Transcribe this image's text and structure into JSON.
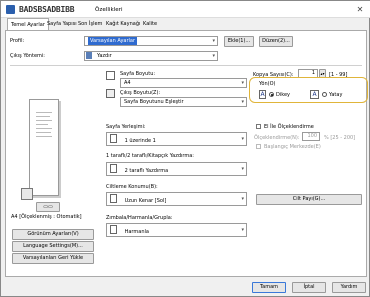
{
  "window": {
    "printer_name": "BADSBSADBIBB",
    "title": "Özellikleri",
    "close_glyph": "✕"
  },
  "tabs": [
    {
      "label": "Temel Ayarlar",
      "active": true
    },
    {
      "label": "Sayfa Yapısı",
      "active": false
    },
    {
      "label": "Son İşlem",
      "active": false
    },
    {
      "label": "Kağıt Kaynağı",
      "active": false
    },
    {
      "label": "Kalite",
      "active": false
    }
  ],
  "profile": {
    "label": "Profil:",
    "value": "Varsayılan Ayarlar",
    "add_button": "Ekle(1)...",
    "edit_button": "Düzen(2)..."
  },
  "output": {
    "label": "Çıkış Yöntemi:",
    "value": "Yazdır"
  },
  "page_size": {
    "label": "Sayfa Boyutu:",
    "value": "A4"
  },
  "output_size": {
    "label": "Çıkış Boyutu(Z):",
    "value": "Sayfa Boyutunu Eşleştir"
  },
  "copies": {
    "label": "Kopya Sayısı(C):",
    "value": "1",
    "range": "[1 - 99]"
  },
  "orientation": {
    "label": "Yön(O)",
    "portrait": "Dikey",
    "landscape": "Yatay",
    "selected": "portrait"
  },
  "layout": {
    "label": "Sayfa Yerleşimi:",
    "value": "1 üzerinde 1"
  },
  "manual_scaling": {
    "label": "El İle Ölçeklendirme",
    "scaling_label": "Ölçeklendirme(N):",
    "scaling_value": "100",
    "scaling_range": "% [25 - 200]",
    "booklet_label": "Başlangıç Merkezde(E)"
  },
  "duplex": {
    "label": "1 taraflı/2 taraflı/Kitapçık Yazdırma:",
    "value": "2 taraflı Yazdırma"
  },
  "binding": {
    "label": "Ciltleme Konumu(B):",
    "value": "Uzun Kenar [Sol]",
    "gutter_button": "Cilt Payı(G)..."
  },
  "finishing": {
    "label": "Zımbala/Harmanla/Grupla:",
    "value": "Harmanla"
  },
  "preview": {
    "caption": "A4 [Ölçeklenmiş : Otomatik]"
  },
  "left_buttons": {
    "view_settings": "Görünüm Ayarları(V)",
    "language_settings": "Language Settings(M)...",
    "restore_defaults": "Varsayılanları Geri Yükle"
  },
  "footer": {
    "ok": "Tamam",
    "cancel": "İptal",
    "help": "Yardım"
  },
  "colors": {
    "accent": "#2f6bd0",
    "highlight_border": "#e0b53a"
  }
}
